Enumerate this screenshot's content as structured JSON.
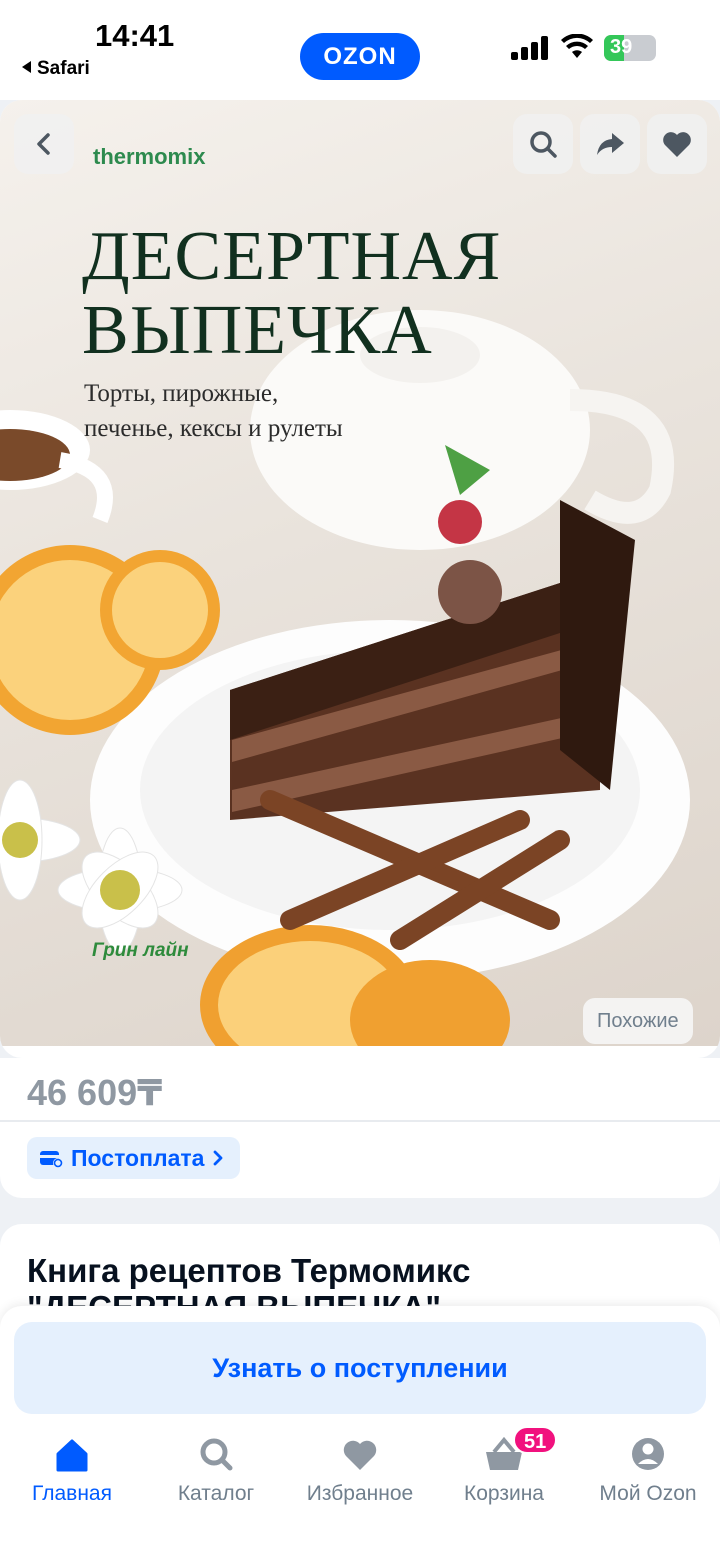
{
  "status_bar": {
    "time": "14:41",
    "back_app": "Safari",
    "brand_pill": "OZON",
    "battery": "39",
    "battery_level": 0.39
  },
  "gallery": {
    "cover": {
      "brand": "thermomix",
      "title_line1": "ДЕСЕРТНАЯ",
      "title_line2": "ВЫПЕЧКА",
      "subtitle_line1": "Торты, пирожные,",
      "subtitle_line2": "печенье, кексы и рулеты",
      "publisher": "Грин лайн"
    },
    "similar_label": "Похожие",
    "icons": [
      "back-icon",
      "search-icon",
      "share-icon",
      "heart-icon"
    ]
  },
  "price": {
    "value": "46 609",
    "currency": "₸"
  },
  "postpay": {
    "label": "Постоплата"
  },
  "product": {
    "title": "Книга рецептов Термомикс \"ДЕСЕРТНАЯ ВЫПЕЧКА\""
  },
  "notify": {
    "label": "Узнать о поступлении"
  },
  "tabbar": {
    "items": [
      {
        "label": "Главная",
        "icon": "home-icon",
        "active": true
      },
      {
        "label": "Каталог",
        "icon": "search-icon"
      },
      {
        "label": "Избранное",
        "icon": "heart-icon"
      },
      {
        "label": "Корзина",
        "icon": "basket-icon",
        "badge": "51"
      },
      {
        "label": "Мой Ozon",
        "icon": "profile-icon"
      }
    ]
  },
  "colors": {
    "accent": "#005bff",
    "badge": "#f1117e",
    "muted": "#707f8d",
    "price": "#8f98a2"
  }
}
